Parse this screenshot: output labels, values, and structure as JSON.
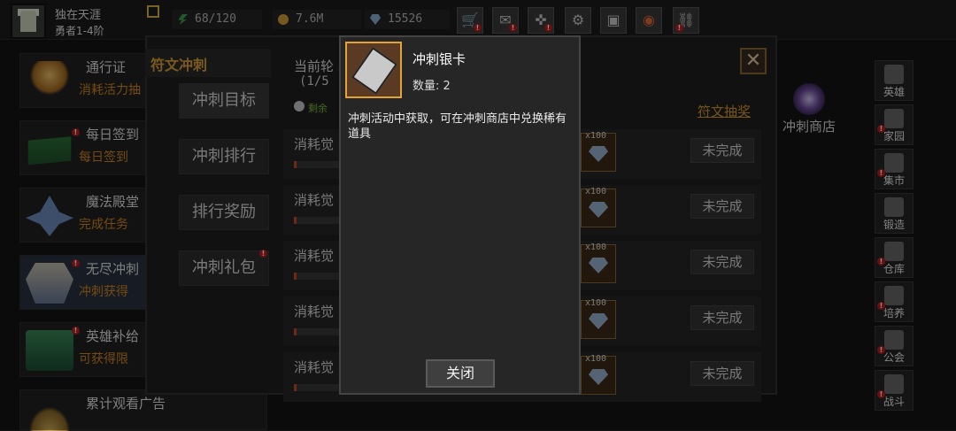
{
  "player": {
    "name": "独在天涯",
    "level": "勇者1-4阶"
  },
  "resources": {
    "stamina": "68/120",
    "gold": "7.6M",
    "gems": "15526"
  },
  "topbar_icons": [
    "shop-cart-icon",
    "mail-icon",
    "gamepad-icon",
    "settings-gear-icon",
    "gift-box-icon",
    "color-wheel-icon",
    "chain-icon"
  ],
  "sidebar": [
    {
      "title": "通行证",
      "subtitle": "消耗活力抽",
      "icon": "chalice-icon",
      "alert": false
    },
    {
      "title": "每日签到",
      "subtitle": "每日签到",
      "icon": "book-icon",
      "alert": true
    },
    {
      "title": "魔法殿堂",
      "subtitle": "完成任务",
      "icon": "crystal-icon",
      "alert": false
    },
    {
      "title": "无尽冲刺",
      "subtitle": "冲刺获得",
      "icon": "armor-icon",
      "alert": true
    },
    {
      "title": "英雄补给",
      "subtitle": "可获得限",
      "icon": "chest-icon",
      "alert": true
    },
    {
      "title": "累计观看广告",
      "subtitle": "",
      "icon": "hat-icon",
      "alert": false
    }
  ],
  "panel": {
    "title": "符文冲刺",
    "nav": [
      "冲刺目标",
      "冲刺排行",
      "排行奖励",
      "冲刺礼包"
    ],
    "header": "当前轮",
    "progress": "(1/5",
    "remaining": "剩余",
    "rune_draw_link": "符文抽奖",
    "tasks": [
      {
        "title": "消耗觉",
        "reward_qty": "x100",
        "status": "未完成",
        "progress": 0.05
      },
      {
        "title": "消耗觉",
        "reward_qty": "x100",
        "status": "未完成",
        "progress": 0.05
      },
      {
        "title": "消耗觉",
        "reward_qty": "x100",
        "status": "未完成",
        "progress": 0.05
      },
      {
        "title": "消耗觉",
        "reward_qty": "x100",
        "status": "未完成",
        "progress": 0.05
      },
      {
        "title": "消耗觉",
        "reward_qty": "x100",
        "status": "未完成",
        "progress": 0.05
      }
    ]
  },
  "sprint_shop": "冲刺商店",
  "dock": [
    "英雄",
    "家园",
    "集市",
    "锻造",
    "仓库",
    "培养",
    "公会",
    "战斗"
  ],
  "modal": {
    "item_name": "冲刺银卡",
    "quantity": "数量: 2",
    "description": "冲刺活动中获取，可在冲刺商店中兑换稀有道具",
    "close_label": "关闭"
  },
  "colors": {
    "accent_orange": "#e0a43a",
    "alert_red": "#c21d1d",
    "progress_fill": "#c84a23"
  }
}
